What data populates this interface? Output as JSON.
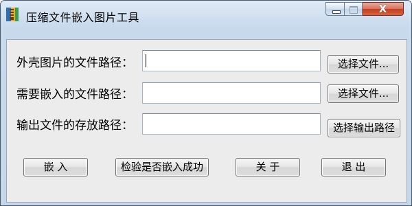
{
  "window": {
    "title": "压缩文件嵌入图片工具",
    "close_glyph": "X",
    "colors": {
      "accent_close": "#c4401f",
      "frame": "#c6d7ea",
      "client": "#ececec"
    }
  },
  "form": {
    "shell_label": "外壳图片的文件路径：",
    "shell_value": "",
    "embed_label": "需要嵌入的文件路径：",
    "embed_value": "",
    "output_label": "输出文件的存放路径：",
    "output_value": ""
  },
  "buttons": {
    "browse_shell": "选择文件...",
    "browse_embed": "选择文件...",
    "browse_output": "选择输出路径",
    "embed": "嵌  入",
    "verify": "检验是否嵌入成功",
    "about": "关  于",
    "exit": "退  出"
  },
  "icons": {
    "app": "app-icon",
    "minimize": "minimize-icon",
    "maximize": "maximize-icon",
    "close": "close-icon"
  }
}
